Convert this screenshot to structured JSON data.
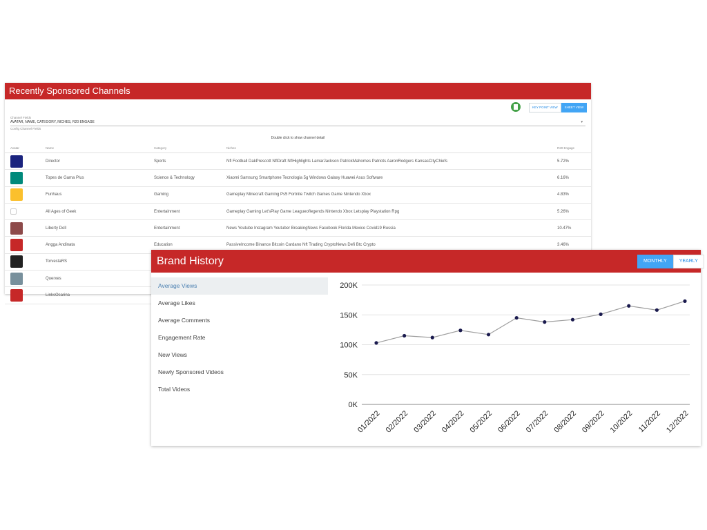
{
  "channels_panel": {
    "title": "Recently Sponsored Channels",
    "key_point_view_label": "KEY POINT VIEW",
    "sheet_view_label": "SHEET VIEW",
    "channel_fields_label": "Channel Fields",
    "channel_fields_value": "AVATAR, NAME, CATEGORY, NICHES, R20 ENGAGE",
    "config_label": "Config Channel Fields",
    "hint": "Double click to show channel detail",
    "columns": [
      "Avatar",
      "Name",
      "Category",
      "Niches",
      "R20 Engage"
    ],
    "rows": [
      {
        "name": "Director",
        "category": "Sports",
        "niches": "Nfl Football DakPrescott NflDraft NflHighlights LamarJackson PatrickMahomes Patriots AaronRodgers KansasCityChiefs",
        "engage": "5.72%",
        "avatar_color": "#1a237e"
      },
      {
        "name": "Topes de Gama Plus",
        "category": "Science & Technology",
        "niches": "Xiaomi Samsung Smartphone Tecnologia 5g Windows Galaxy Huawei Asus Software",
        "engage": "6.16%",
        "avatar_color": "#00897b"
      },
      {
        "name": "Funhaus",
        "category": "Gaming",
        "niches": "Gameplay Minecraft Gaming Ps5 Fortnite Twitch Games Game Nintendo Xbox",
        "engage": "4.83%",
        "avatar_color": "#fbc02d"
      },
      {
        "name": "All Ages of Geek",
        "category": "Entertainment",
        "niches": "Gameplay Gaming Let'sPlay Game Leagueoflegends Nintendo Xbox Letsplay Playstation Rpg",
        "engage": "5.26%",
        "avatar_color": "#ffffff"
      },
      {
        "name": "Liberty Doll",
        "category": "Entertainment",
        "niches": "News Youtube Instagram Youtuber BreakingNews Facebook Florida Mexico Covid19 Russia",
        "engage": "10.47%",
        "avatar_color": "#8d4a4a"
      },
      {
        "name": "Angga Andinata",
        "category": "Education",
        "niches": "PassiveIncome Binance Bitcoin Cardano Nft Trading CryptoNews Defi Btc Crypto",
        "engage": "3.46%",
        "avatar_color": "#c62828"
      },
      {
        "name": "TorvestaRS",
        "category": "",
        "niches": "",
        "engage": "",
        "avatar_color": "#212121"
      },
      {
        "name": "Querxes",
        "category": "",
        "niches": "",
        "engage": "",
        "avatar_color": "#78909c"
      },
      {
        "name": "LinksOcarina",
        "category": "",
        "niches": "",
        "engage": "",
        "avatar_color": "#c62828"
      }
    ]
  },
  "brand_history": {
    "title": "Brand History",
    "monthly_label": "MONTHLY",
    "yearly_label": "YEARLY",
    "metrics": [
      "Average Views",
      "Average Likes",
      "Average Comments",
      "Engagement Rate",
      "New Views",
      "Newly Sponsored Videos",
      "Total Videos"
    ]
  },
  "chart_data": {
    "type": "line",
    "categories": [
      "01/2022",
      "02/2022",
      "03/2022",
      "04/2022",
      "05/2022",
      "06/2022",
      "07/2022",
      "08/2022",
      "09/2022",
      "10/2022",
      "11/2022",
      "12/2022"
    ],
    "values": [
      103000,
      115000,
      112000,
      124000,
      117000,
      145000,
      138000,
      142000,
      151000,
      165000,
      158000,
      173000
    ],
    "yticks": [
      0,
      50000,
      100000,
      150000,
      200000
    ],
    "ytick_labels": [
      "0K",
      "50K",
      "100K",
      "150K",
      "200K"
    ],
    "ylim": [
      0,
      200000
    ],
    "grid": true,
    "line_color": "#9e9e9e",
    "point_color": "#1a1a4e"
  }
}
